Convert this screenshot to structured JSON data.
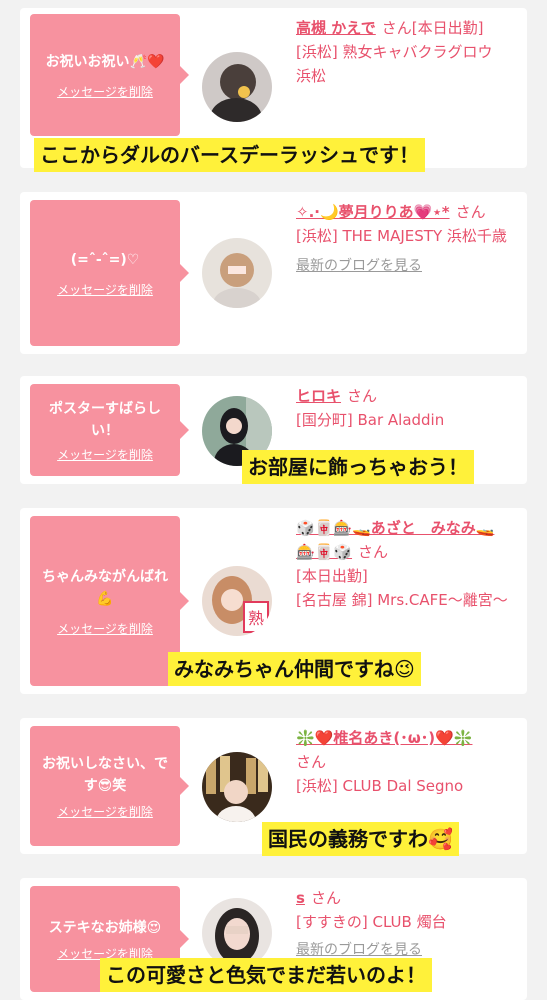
{
  "cards": [
    {
      "message": "お祝いお祝い🥂❤️",
      "delete": "メッセージを削除",
      "name": "高槻 かえで",
      "san": "さん",
      "shop_lines": [
        "[本日出勤]",
        "[浜松] 熟女キャバクラグロウ 浜松"
      ],
      "caption": "ここからダルのバースデーラッシュです！"
    },
    {
      "message": "(=ˆ-ˆ=)♡",
      "delete": "メッセージを削除",
      "name": "✧.·🌙夢月りりあ💗⋆*",
      "san": "さん",
      "shop_lines": [
        "[浜松] THE MAJESTY 浜松千歳"
      ],
      "blog": "最新のブログを見る"
    },
    {
      "message": "ポスターすばらしい！",
      "delete": "メッセージを削除",
      "name": "ヒロキ",
      "san": "さん",
      "shop_lines": [
        "[国分町] Bar Aladdin"
      ],
      "caption": "お部屋に飾っちゃおう！"
    },
    {
      "message": "ちゃんみながんばれ💪",
      "delete": "メッセージを削除",
      "name": "🎲🀄️🎰🚤あざと　みなみ🚤🎰🀄️🎲",
      "san": "さん",
      "shop_lines": [
        "[本日出勤]",
        "[名古屋 錦] Mrs.CAFE〜離宮〜"
      ],
      "caption": "みなみちゃん仲間ですね😉"
    },
    {
      "message": "お祝いしなさい、です😎笑",
      "delete": "メッセージを削除",
      "name": "❇️❤️椎名あき(･ω･)❤️❇️",
      "san": "さん",
      "shop_lines": [
        "[浜松] CLUB Dal Segno"
      ],
      "caption": "国民の義務ですわ🥰"
    },
    {
      "message": "ステキなお姉様😍",
      "delete": "メッセージを削除",
      "name": "s",
      "san": "さん",
      "shop_lines": [
        "[すすきの] CLUB 燭台"
      ],
      "blog": "最新のブログを見る",
      "caption": "この可愛さと色気でまだ若いのよ！"
    }
  ],
  "colors": {
    "bubble": "#f7929f",
    "accent": "#e8516c",
    "caption_bg": "#fff13a"
  }
}
